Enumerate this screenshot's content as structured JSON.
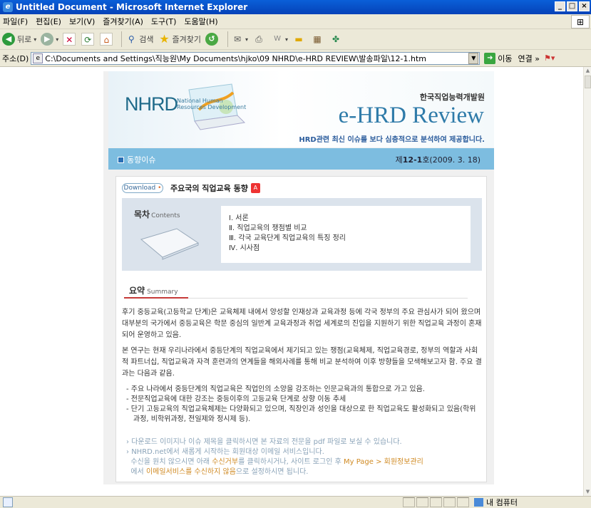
{
  "window": {
    "title": "Untitled Document - Microsoft Internet Explorer",
    "min": "_",
    "max": "□",
    "close": "×"
  },
  "menu": [
    "파일(F)",
    "편집(E)",
    "보기(V)",
    "즐겨찾기(A)",
    "도구(T)",
    "도움말(H)"
  ],
  "toolbar": {
    "back": "뒤로",
    "search": "검색",
    "favorites": "즐겨찾기"
  },
  "address": {
    "label": "주소(D)",
    "value": "C:\\Documents and Settings\\직능원\\My Documents\\hjko\\09 NHRD\\e-HRD REVIEW\\발송파일\\12-1.htm",
    "go": "이동",
    "links": "연결 »"
  },
  "status": {
    "zone": "내 컴퓨터"
  },
  "colors": {
    "accent": "#7dbde0",
    "title_blue": "#2f7ba9",
    "highlight": "#d08a23",
    "underline": "#c63a38"
  },
  "header": {
    "logo": "NHRD",
    "logo_sub": [
      "National Human",
      "Resources Development"
    ],
    "org": "한국직업능력개발원",
    "brand": "e-HRD Review",
    "tagline": "HRD관련 최신 이슈를 보다 심층적으로 분석하여 제공합니다."
  },
  "category": {
    "label": "동향이슈",
    "issue_prefix": "제",
    "issue_num": "12-1",
    "issue_suffix": "호(2009. 3. 18)"
  },
  "download": {
    "button": "Download",
    "title": "주요국의 직업교육 동향"
  },
  "toc": {
    "title": "목차",
    "title_en": "Contents",
    "items": [
      "Ⅰ. 서론",
      "Ⅱ. 직업교육의 쟁점별 비교",
      "Ⅲ. 각국 교육단계 직업교육의 특징 정리",
      "Ⅳ. 시사점"
    ]
  },
  "summary": {
    "title": "요약",
    "title_en": "Summary",
    "para1": "후기 중등교육(고등학교 단계)은 교육체제 내에서 양성할 인재상과 교육과정 등에 각국 정부의 주요 관심사가 되어 왔으며 대부분의 국가에서 중등교육은 학문 중심의 일반계 교육과정과 취업 세계로의 진입을 지원하기 위한 직업교육 과정이 혼재되어 운영하고 있음.",
    "para2": "본 연구는 현재 우리나라에서 중등단계의 직업교육에서 제기되고 있는 쟁점(교육체제, 직업교육경로, 정부의 역할과 사회적 파트너십, 직업교육과 자격 훈련과의 연계들을 해외사례를 통해 비교 분석하여 이후 방향들을 모색해보고자 함. 주요 결과는 다음과 같음.",
    "bullets": [
      "- 주요 나라에서 중등단계의 직업교육은 직업인의 소양을 강조하는 인문교육과의 통합으로 가고 있음.",
      "- 전문직업교육에 대한 강조는 중등이후의 고등교육 단계로 상향 이동 추세",
      "- 단기 고등교육의 직업교육체제는 다양화되고 있으며, 직장인과 성인을 대상으로 한 직업교육도 활성화되고 있음(학위과정, 비학위과정, 전일제와 정시제 등)."
    ]
  },
  "notes": {
    "n1": "다운로드 이미지나 이슈 제목을 클릭하시면 본 자료의 전문을 pdf 파일로 보실 수 있습니다.",
    "n2": "NHRD.net에서 새롭게 시작하는 회원대상 이메일 서비스입니다.",
    "n3a": "수신을 원치 않으시면 아래 ",
    "n3b": "수신거부",
    "n3c": "를 클릭하시거나, 사이트 로그인 후 ",
    "n3d": "My Page > 회원정보관리",
    "n4a": "에서 ",
    "n4b": "이메일서비스를 수신하지 않음",
    "n4c": "으로 설정하시면 됩니다."
  }
}
